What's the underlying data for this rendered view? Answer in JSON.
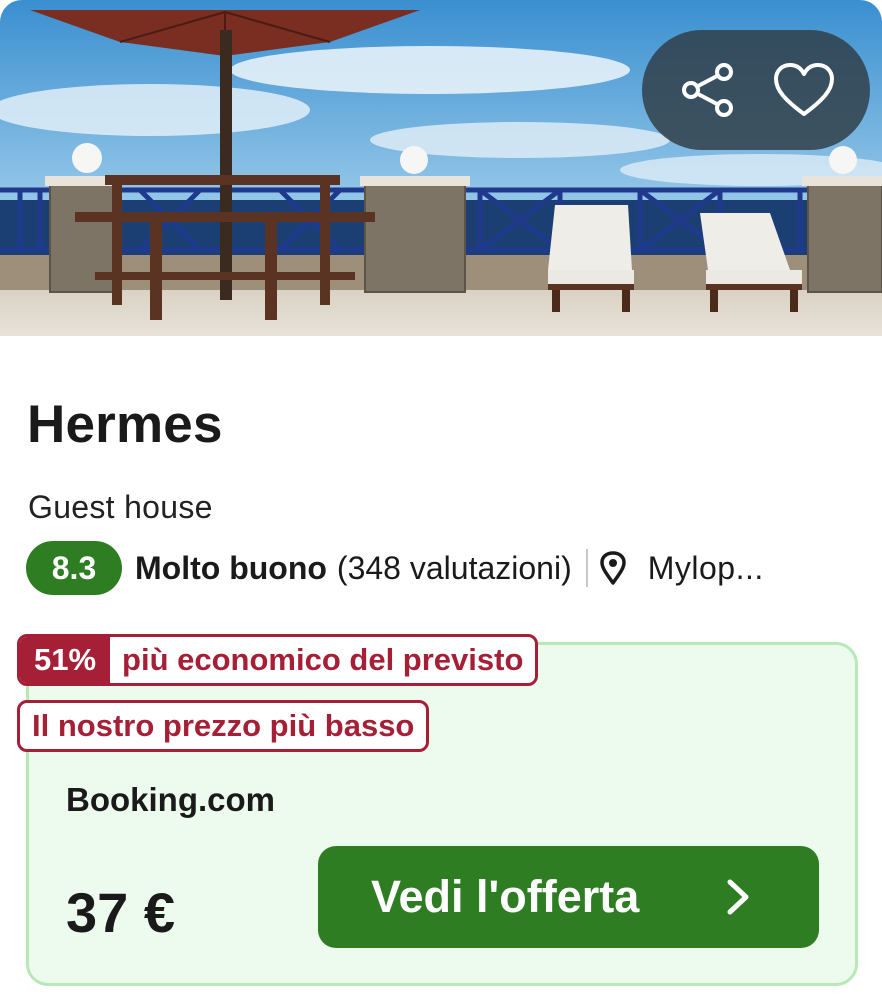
{
  "header": {
    "photo_description": "terrace-with-umbrella-table-and-sunbeds",
    "share_icon": "share-icon",
    "favorite_icon": "heart-icon"
  },
  "hotel": {
    "name": "Hermes",
    "type": "Guest house",
    "score": "8.3",
    "rating_word": "Molto buono",
    "rating_count": "(348 valutazioni)",
    "location": "Mylop..."
  },
  "deal": {
    "percent": "51%",
    "text": "più economico del previsto",
    "lowest_price": "Il nostro prezzo più basso"
  },
  "offer": {
    "provider": "Booking.com",
    "price": "37 €",
    "cta_label": "Vedi l'offerta"
  },
  "colors": {
    "score_green": "#2e7d23",
    "deal_red": "#a51f36",
    "panel_bg": "#edfbee",
    "panel_border": "#b7e9b8"
  }
}
